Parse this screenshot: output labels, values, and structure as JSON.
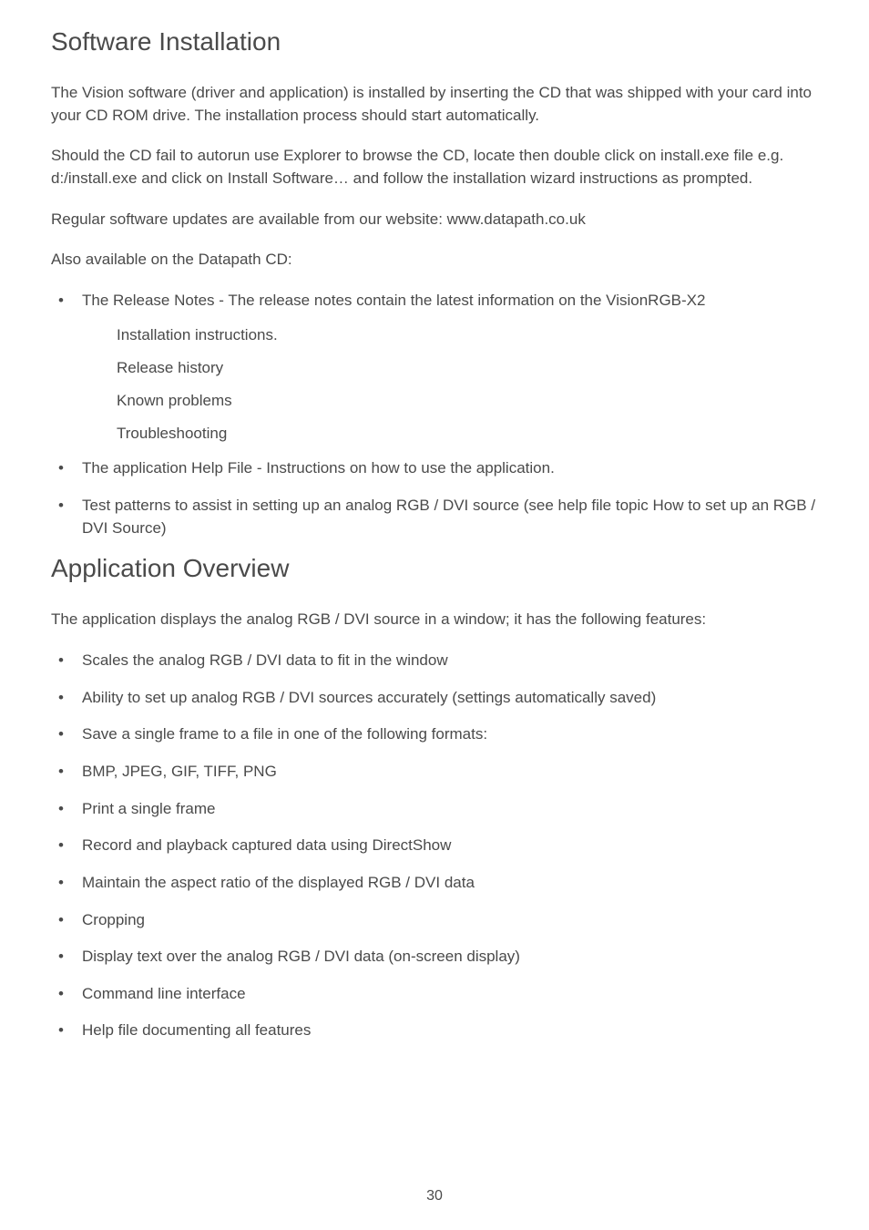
{
  "section1": {
    "heading": "Software Installation",
    "para1": "The Vision software (driver and application) is installed by inserting the CD that was shipped with your card into your CD ROM drive.  The installation process should start automatically.",
    "para2": "Should the CD fail to autorun use Explorer to browse the CD, locate then double click on install.exe file e.g. d:/install.exe and click on Install Software… and follow the installation wizard instructions as prompted.",
    "para3": "Regular software updates are available from our website:  www.datapath.co.uk",
    "para4": "Also available on the Datapath CD:",
    "bullets": {
      "b1": "The Release Notes  -  The release notes contain the latest information on the VisionRGB-X2",
      "sub1": "Installation instructions.",
      "sub2": "Release history",
      "sub3": "Known problems",
      "sub4": "Troubleshooting",
      "b2": "The application Help File  -  Instructions on how to use the application.",
      "b3": "Test patterns to assist in setting up an analog RGB / DVI source (see help file topic  How to set up an RGB / DVI Source)"
    }
  },
  "section2": {
    "heading": "Application Overview",
    "para1": "The application displays the analog RGB / DVI source in a window; it has the following features:",
    "bullets": {
      "b1": "Scales the analog RGB / DVI data to fit in the window",
      "b2": "Ability to set up analog RGB / DVI sources accurately (settings automatically saved)",
      "b3": "Save a single frame to a file in one of the following formats:",
      "b4": "BMP, JPEG, GIF, TIFF, PNG",
      "b5": "Print a single frame",
      "b6": "Record and playback captured data using DirectShow",
      "b7": "Maintain the aspect ratio of the displayed RGB / DVI data",
      "b8": "Cropping",
      "b9": "Display text over the analog RGB / DVI data (on-screen display)",
      "b10": "Command line interface",
      "b11": "Help file documenting all features"
    }
  },
  "pageNumber": "30"
}
